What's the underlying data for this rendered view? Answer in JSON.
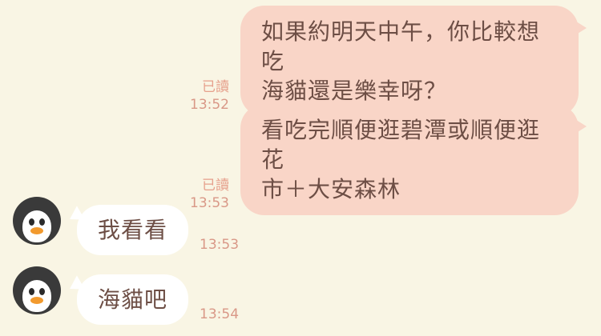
{
  "messages": {
    "outgoing": [
      {
        "text_line1": "如果約明天中午，你比較想吃",
        "text_line2": "海貓還是樂幸呀？",
        "read": "已讀",
        "time": "13:52"
      },
      {
        "text_line1": "看吃完順便逛碧潭或順便逛花",
        "text_line2": "市＋大安森林",
        "read": "已讀",
        "time": "13:53"
      }
    ],
    "incoming": [
      {
        "text": "我看看",
        "time": "13:53"
      },
      {
        "text": "海貓吧",
        "time": "13:54"
      }
    ]
  },
  "avatar": {
    "icon": "penguin-avatar-icon"
  },
  "colors": {
    "background": "#f9f5e4",
    "outgoing_bubble": "#f9d5c7",
    "incoming_bubble": "#ffffff",
    "text": "#6d4e45",
    "meta": "#d99887"
  }
}
